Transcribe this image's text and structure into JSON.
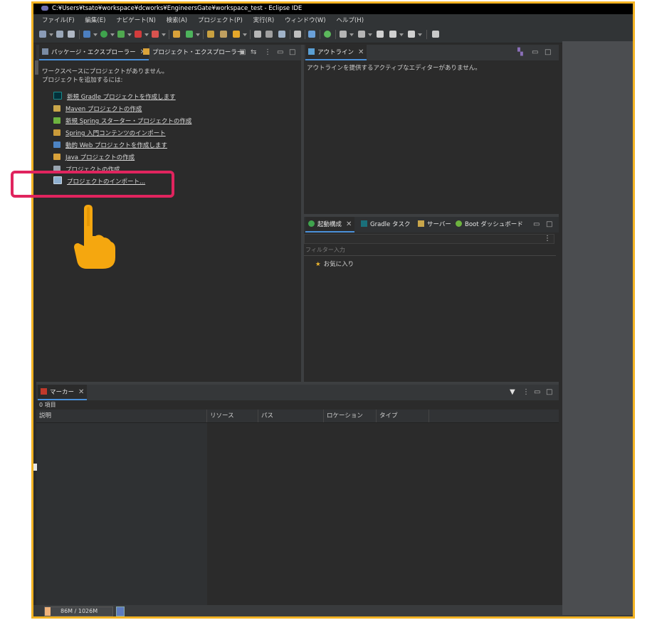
{
  "window": {
    "title": "C:¥Users¥tsato¥workspace¥dcworks¥EngineersGate¥workspace_test - Eclipse IDE"
  },
  "menu": [
    "ファイル(F)",
    "編集(E)",
    "ナビゲート(N)",
    "検索(A)",
    "プロジェクト(P)",
    "実行(R)",
    "ウィンドウ(W)",
    "ヘルプ(H)"
  ],
  "package_explorer": {
    "tab_label": "パッケージ・エクスプローラー",
    "tab2_label": "プロジェクト・エクスプローラー",
    "message1": "ワークスペースにプロジェクトがありません。",
    "message2": "プロジェクトを追加するには:",
    "links": [
      {
        "label": "新規 Gradle プロジェクトを作成します",
        "icon": "gradle-icon"
      },
      {
        "label": "Maven プロジェクトの作成",
        "icon": "maven-icon"
      },
      {
        "label": "新規 Spring スターター・プロジェクトの作成",
        "icon": "spring-icon"
      },
      {
        "label": "Spring 入門コンテンツのインポート",
        "icon": "spring-import-icon"
      },
      {
        "label": "動的 Web プロジェクトを作成します",
        "icon": "web-project-icon"
      },
      {
        "label": "Java プロジェクトの作成",
        "icon": "java-project-icon"
      },
      {
        "label": "プロジェクトの作成",
        "icon": "project-icon"
      },
      {
        "label": "プロジェクトのインポート...",
        "icon": "import-icon"
      }
    ]
  },
  "outline": {
    "tab_label": "アウトライン",
    "message": "アウトラインを提供するアクティブなエディターがありません。"
  },
  "launch_panel": {
    "tabs": [
      "起動構成",
      "Gradle タスク",
      "サーバー",
      "Boot ダッシュボード"
    ],
    "filter_placeholder": "フィルター入力",
    "favorites": "お気に入り"
  },
  "markers": {
    "tab_label": "マーカー",
    "count": "0 項目",
    "columns": [
      "説明",
      "リソース",
      "パス",
      "ロケーション",
      "タイプ"
    ]
  },
  "status": {
    "memory": "86M / 1026M",
    "memory_used_fraction": 0.084
  },
  "colors": {
    "highlight": "#e0245e",
    "frame": "#f3b323",
    "link_tab_underline": "#4a90d9"
  }
}
